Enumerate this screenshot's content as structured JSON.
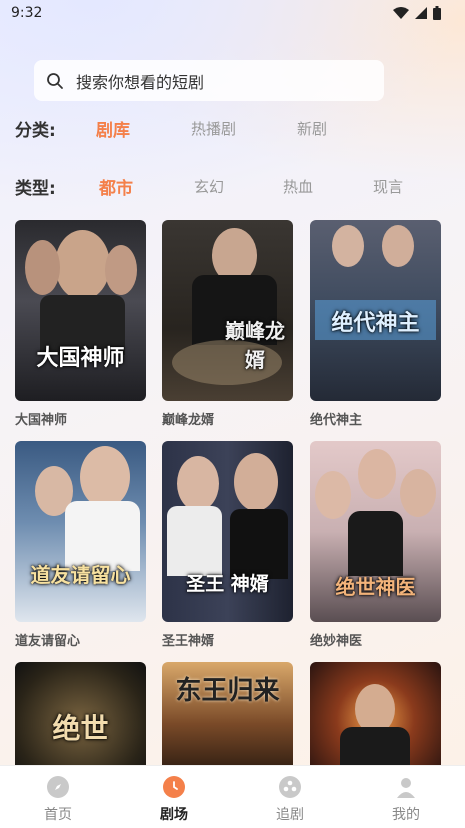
{
  "status_bar": {
    "time": "9:32"
  },
  "search": {
    "placeholder": "搜索你想看的短剧"
  },
  "category": {
    "label": "分类:",
    "options": [
      "剧库",
      "热播剧",
      "新剧"
    ],
    "selected": "剧库"
  },
  "genre": {
    "label": "类型:",
    "options": [
      "都市",
      "玄幻",
      "热血",
      "现言"
    ],
    "selected": "都市"
  },
  "dramas": [
    {
      "title": "大国神师",
      "poster_text": "大国神师"
    },
    {
      "title": "巅峰龙婿",
      "poster_text": "巅峰龙婿"
    },
    {
      "title": "绝代神主",
      "poster_text": "绝代神主"
    },
    {
      "title": "道友请留心",
      "poster_text": "道友请留心"
    },
    {
      "title": "圣王神婿",
      "poster_text": "圣王 神婿"
    },
    {
      "title": "绝妙神医",
      "poster_text": "绝世神医"
    },
    {
      "title": "",
      "poster_text": "绝世"
    },
    {
      "title": "",
      "poster_text": "东王归来"
    },
    {
      "title": "",
      "poster_text": ""
    }
  ],
  "tabbar": {
    "items": [
      {
        "label": "首页",
        "icon": "compass-icon"
      },
      {
        "label": "剧场",
        "icon": "clock-icon"
      },
      {
        "label": "追剧",
        "icon": "film-reel-icon"
      },
      {
        "label": "我的",
        "icon": "user-icon"
      }
    ],
    "active": "剧场"
  },
  "colors": {
    "accent": "#f4804a",
    "inactive": "#999999"
  }
}
